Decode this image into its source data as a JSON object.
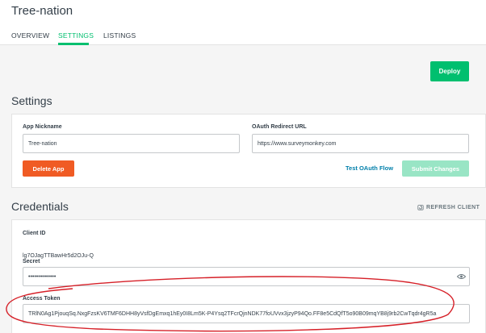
{
  "header": {
    "app_title": "Tree-nation",
    "tabs": [
      {
        "label": "OVERVIEW",
        "active": false
      },
      {
        "label": "SETTINGS",
        "active": true
      },
      {
        "label": "LISTINGS",
        "active": false
      }
    ]
  },
  "deploy_label": "Deploy",
  "settings": {
    "title": "Settings",
    "nickname_label": "App Nickname",
    "nickname_value": "Tree-nation",
    "redirect_label": "OAuth Redirect URL",
    "redirect_value": "https://www.surveymonkey.com",
    "delete_label": "Delete App",
    "test_oauth_label": "Test OAuth Flow",
    "submit_label": "Submit Changes"
  },
  "credentials": {
    "title": "Credentials",
    "refresh_label": "REFRESH CLIENT",
    "client_id_label": "Client ID",
    "client_id_value": "lg7OJagTTBawHr5d2OJu-Q",
    "secret_label": "Secret",
    "secret_value": "••••••••••••••",
    "access_token_label": "Access Token",
    "access_token_value": "TRlN0Ag1PjouqSq.NxgFzsKV6TMF6DHH8yVsfDgEmxq1hEy0I8Lm5K-P4Ysq2TFcrQjnNDK77foUVvx3jzyP94Qo.FF8e5CdQfT5o90B09mqYB8j9rb2CwTqdr4gR5a"
  },
  "colors": {
    "accent": "#00bf6f",
    "danger": "#f05b24",
    "link": "#007faa",
    "annotation": "#d62028"
  }
}
